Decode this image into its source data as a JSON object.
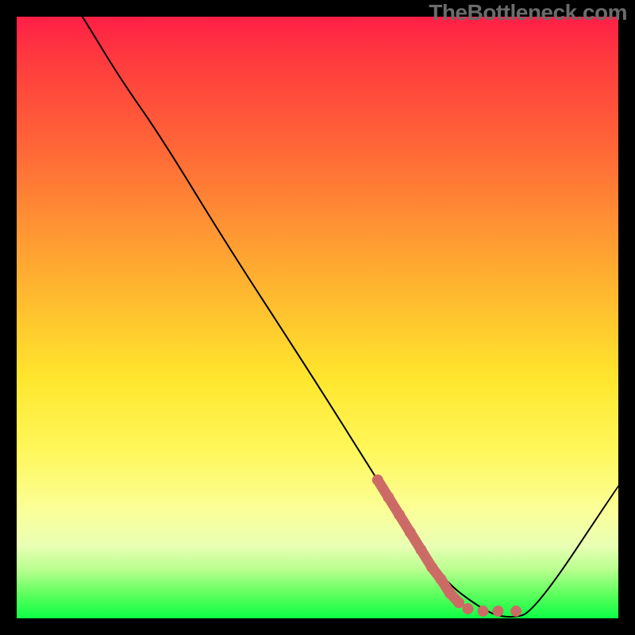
{
  "watermark": "TheBottleneck.com",
  "colors": {
    "frame_border": "#000000",
    "curve_stroke": "#000000",
    "marker": "#cc6b66"
  },
  "chart_data": {
    "type": "line",
    "title": "",
    "xlabel": "",
    "ylabel": "",
    "xlim": [
      0,
      100
    ],
    "ylim": [
      0,
      100
    ],
    "grid": false,
    "legend": false,
    "series": [
      {
        "name": "bottleneck-curve",
        "x": [
          0,
          11,
          17,
          24,
          35,
          48,
          60,
          70,
          78,
          82,
          86,
          100
        ],
        "y": [
          117,
          100,
          90,
          80,
          62,
          42,
          23,
          7,
          1,
          0,
          1,
          22
        ]
      }
    ],
    "markers": [
      {
        "x": 60.0,
        "y": 23.0
      },
      {
        "x": 61.8,
        "y": 20.1
      },
      {
        "x": 63.6,
        "y": 17.2
      },
      {
        "x": 65.4,
        "y": 14.3
      },
      {
        "x": 67.2,
        "y": 11.4
      },
      {
        "x": 69.0,
        "y": 8.5
      },
      {
        "x": 70.5,
        "y": 6.5
      },
      {
        "x": 72.0,
        "y": 4.2
      },
      {
        "x": 73.5,
        "y": 2.6
      },
      {
        "x": 75.0,
        "y": 1.6
      },
      {
        "x": 77.5,
        "y": 1.2
      },
      {
        "x": 80.0,
        "y": 1.2
      },
      {
        "x": 83.0,
        "y": 1.2
      }
    ],
    "background_gradient_stops": [
      {
        "pct": 0,
        "color": "#ff1f47"
      },
      {
        "pct": 22,
        "color": "#ff6737"
      },
      {
        "pct": 48,
        "color": "#ffbf2f"
      },
      {
        "pct": 72,
        "color": "#fff75a"
      },
      {
        "pct": 92,
        "color": "#b7ff8e"
      },
      {
        "pct": 100,
        "color": "#0cff46"
      }
    ]
  }
}
